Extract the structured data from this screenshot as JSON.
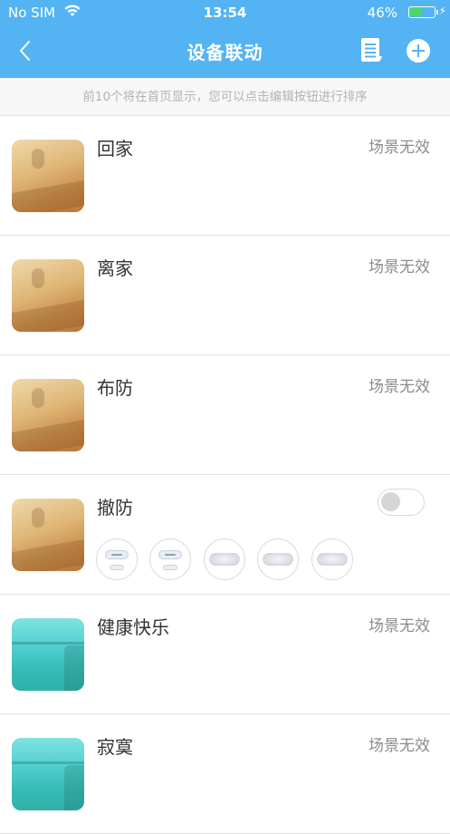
{
  "status_bar": {
    "carrier": "No SIM",
    "time": "13:54",
    "battery_percent": "46%",
    "battery_level": 0.46
  },
  "nav": {
    "title": "设备联动",
    "back_icon": "chevron-left-icon",
    "edit_icon": "document-list-icon",
    "add_icon": "plus-circle-icon"
  },
  "tip": "前10个将在首页显示，您可以点击编辑按钮进行排序",
  "scenes": [
    {
      "name": "回家",
      "status": "场景无效",
      "thumb": "warm"
    },
    {
      "name": "离家",
      "status": "场景无效",
      "thumb": "warm"
    },
    {
      "name": "布防",
      "status": "场景无效",
      "thumb": "warm"
    },
    {
      "name": "撤防",
      "status": "",
      "thumb": "warm",
      "toggle_on": false,
      "device_count": 5
    },
    {
      "name": "健康快乐",
      "status": "场景无效",
      "thumb": "teal"
    },
    {
      "name": "寂寞",
      "status": "场景无效",
      "thumb": "teal"
    }
  ],
  "colors": {
    "header": "#54b4f3",
    "battery_fill": "#4cd964"
  }
}
